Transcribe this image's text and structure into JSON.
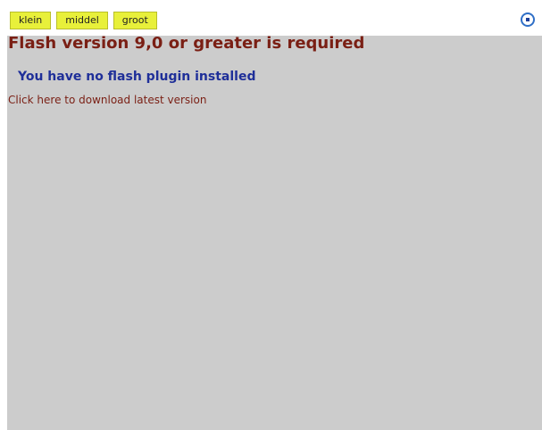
{
  "toolbar": {
    "buttons": [
      {
        "label": "klein"
      },
      {
        "label": "middel"
      },
      {
        "label": "groot"
      }
    ],
    "close_icon": "stop-icon",
    "accent_color": "#e8f03a"
  },
  "flash": {
    "title": "Flash version 9,0 or greater is required",
    "subtitle": "You have no flash plugin installed",
    "download_link": "Click here to download latest version",
    "background_color": "#cccccc",
    "title_color": "#7a1f14",
    "subtitle_color": "#1f2f99"
  }
}
